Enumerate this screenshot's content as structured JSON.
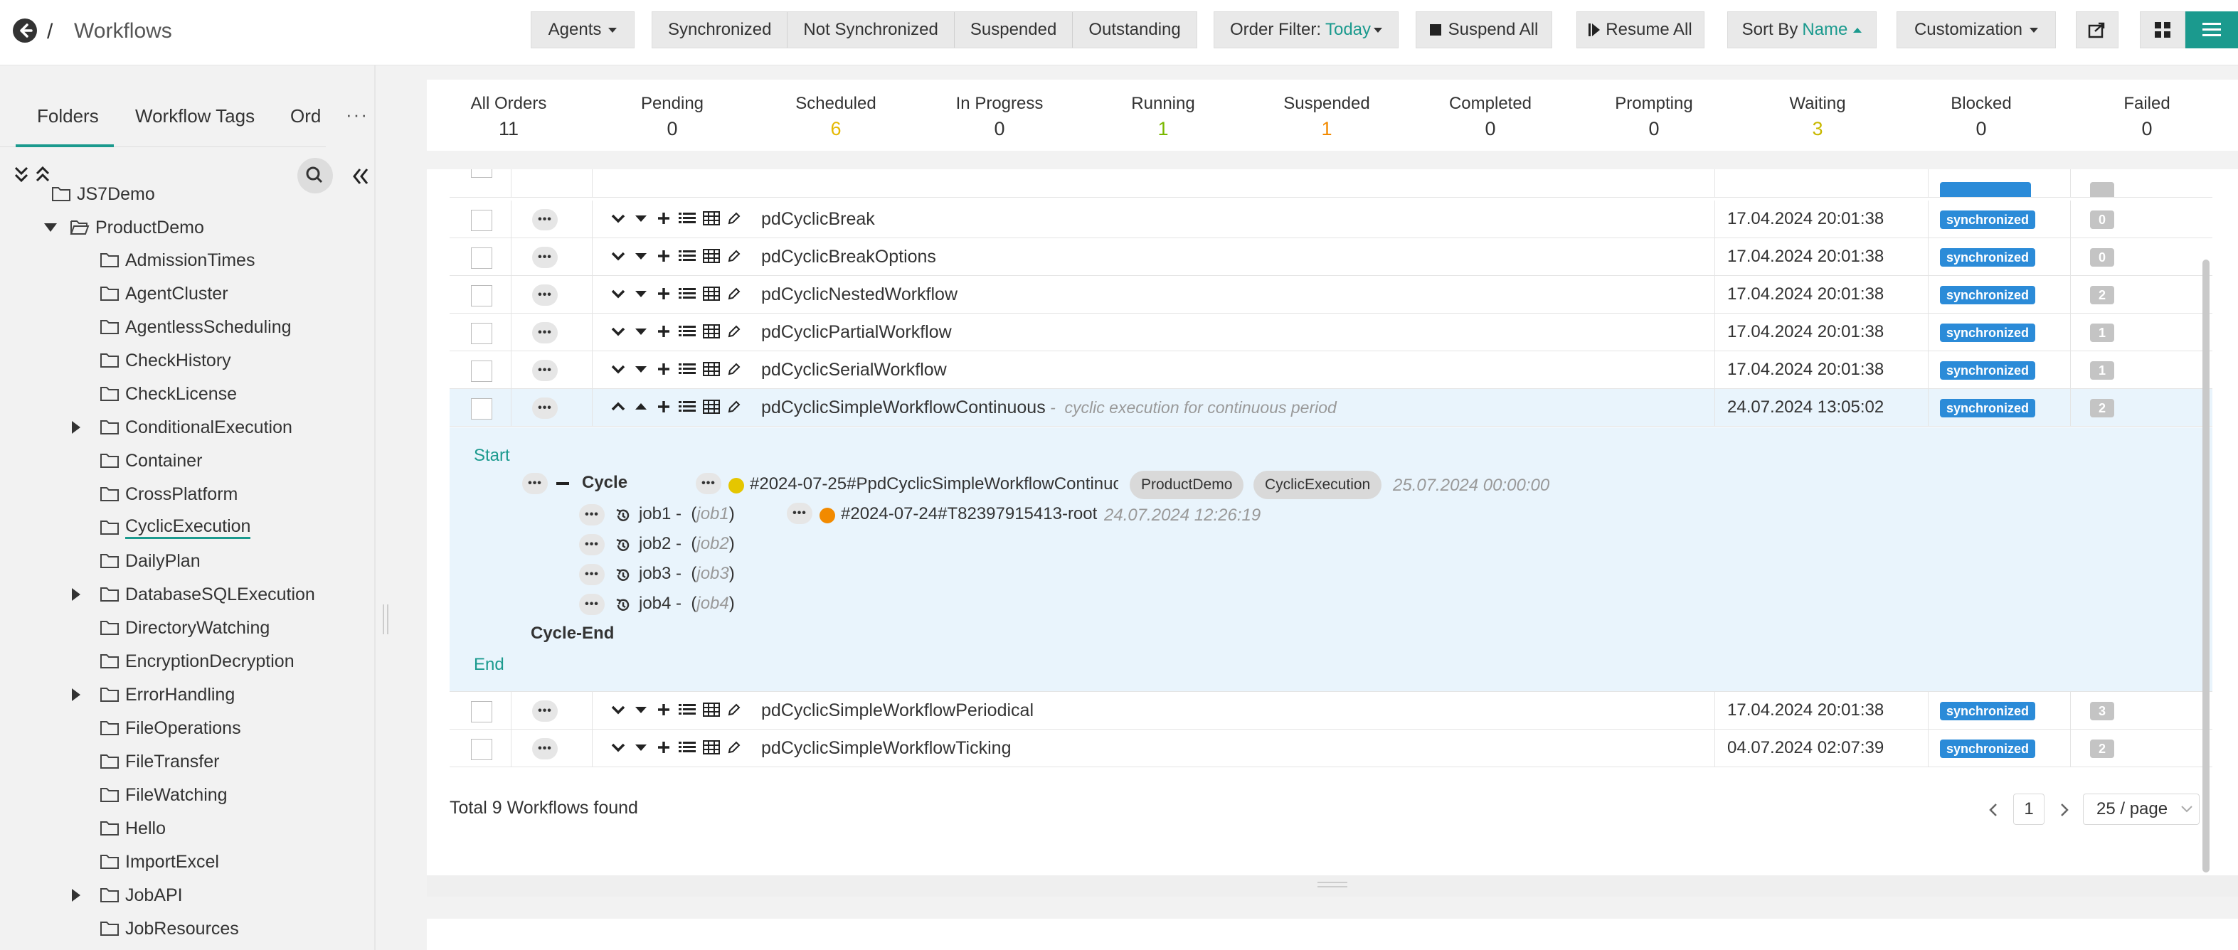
{
  "header": {
    "title": "Workflows",
    "separator": "/",
    "agents_label": "Agents",
    "filters": [
      "Synchronized",
      "Not Synchronized",
      "Suspended",
      "Outstanding"
    ],
    "order_filter_label": "Order Filter:",
    "order_filter_value": "Today",
    "suspend_all": "Suspend All",
    "resume_all": "Resume All",
    "sort_by_label": "Sort By",
    "sort_by_value": "Name",
    "customization": "Customization"
  },
  "sidebar": {
    "tabs": [
      "Folders",
      "Workflow Tags",
      "Ord"
    ],
    "more": "···",
    "partial_top": "JS7Demo",
    "parent": "ProductDemo",
    "items": [
      {
        "label": "AdmissionTimes",
        "expandable": false
      },
      {
        "label": "AgentCluster",
        "expandable": false
      },
      {
        "label": "AgentlessScheduling",
        "expandable": false
      },
      {
        "label": "CheckHistory",
        "expandable": false
      },
      {
        "label": "CheckLicense",
        "expandable": false
      },
      {
        "label": "ConditionalExecution",
        "expandable": true
      },
      {
        "label": "Container",
        "expandable": false
      },
      {
        "label": "CrossPlatform",
        "expandable": false
      },
      {
        "label": "CyclicExecution",
        "expandable": false,
        "selected": true
      },
      {
        "label": "DailyPlan",
        "expandable": false
      },
      {
        "label": "DatabaseSQLExecution",
        "expandable": true
      },
      {
        "label": "DirectoryWatching",
        "expandable": false
      },
      {
        "label": "EncryptionDecryption",
        "expandable": false
      },
      {
        "label": "ErrorHandling",
        "expandable": true
      },
      {
        "label": "FileOperations",
        "expandable": false
      },
      {
        "label": "FileTransfer",
        "expandable": false
      },
      {
        "label": "FileWatching",
        "expandable": false
      },
      {
        "label": "Hello",
        "expandable": false
      },
      {
        "label": "ImportExcel",
        "expandable": false
      },
      {
        "label": "JobAPI",
        "expandable": true
      },
      {
        "label": "JobResources",
        "expandable": false
      }
    ]
  },
  "summary": [
    {
      "label": "All Orders",
      "value": "11",
      "color": "#333333"
    },
    {
      "label": "Pending",
      "value": "0",
      "color": "#333333"
    },
    {
      "label": "Scheduled",
      "value": "6",
      "color": "#e5b800"
    },
    {
      "label": "In Progress",
      "value": "0",
      "color": "#333333"
    },
    {
      "label": "Running",
      "value": "1",
      "color": "#7ab800"
    },
    {
      "label": "Suspended",
      "value": "1",
      "color": "#f28a00"
    },
    {
      "label": "Completed",
      "value": "0",
      "color": "#333333"
    },
    {
      "label": "Prompting",
      "value": "0",
      "color": "#333333"
    },
    {
      "label": "Waiting",
      "value": "3",
      "color": "#c8b800"
    },
    {
      "label": "Blocked",
      "value": "0",
      "color": "#333333"
    },
    {
      "label": "Failed",
      "value": "0",
      "color": "#333333"
    }
  ],
  "rows": [
    {
      "name": "pdCyclicBreak",
      "desc": "",
      "date": "17.04.2024 20:01:38",
      "status": "synchronized",
      "count": "0"
    },
    {
      "name": "pdCyclicBreakOptions",
      "desc": "",
      "date": "17.04.2024 20:01:38",
      "status": "synchronized",
      "count": "0"
    },
    {
      "name": "pdCyclicNestedWorkflow",
      "desc": "",
      "date": "17.04.2024 20:01:38",
      "status": "synchronized",
      "count": "2"
    },
    {
      "name": "pdCyclicPartialWorkflow",
      "desc": "",
      "date": "17.04.2024 20:01:38",
      "status": "synchronized",
      "count": "1"
    },
    {
      "name": "pdCyclicSerialWorkflow",
      "desc": "",
      "date": "17.04.2024 20:01:38",
      "status": "synchronized",
      "count": "1"
    },
    {
      "name": "pdCyclicSimpleWorkflowContinuous",
      "desc": "cyclic execution for continuous period",
      "date": "24.07.2024 13:05:02",
      "status": "synchronized",
      "count": "2",
      "expanded": true
    },
    {
      "name": "pdCyclicSimpleWorkflowPeriodical",
      "desc": "",
      "date": "17.04.2024 20:01:38",
      "status": "synchronized",
      "count": "3"
    },
    {
      "name": "pdCyclicSimpleWorkflowTicking",
      "desc": "",
      "date": "04.07.2024 02:07:39",
      "status": "synchronized",
      "count": "2"
    }
  ],
  "expanded": {
    "start": "Start",
    "cycle": "Cycle",
    "cycle_end": "Cycle-End",
    "end": "End",
    "order_id": "#2024-07-25#PpdCyclicSimpleWorkflowContinuo",
    "tags": [
      "ProductDemo",
      "CyclicExecution"
    ],
    "order_date": "25.07.2024 00:00:00",
    "jobs": [
      {
        "name": "job1",
        "label": "job1"
      },
      {
        "name": "job2",
        "label": "job2"
      },
      {
        "name": "job3",
        "label": "job3"
      },
      {
        "name": "job4",
        "label": "job4"
      }
    ],
    "sub_order_id": "#2024-07-24#T82397915413-root",
    "sub_order_date": "24.07.2024 12:26:19"
  },
  "footer": {
    "total": "Total 9 Workflows found",
    "page": "1",
    "per_page": "25 / page"
  }
}
